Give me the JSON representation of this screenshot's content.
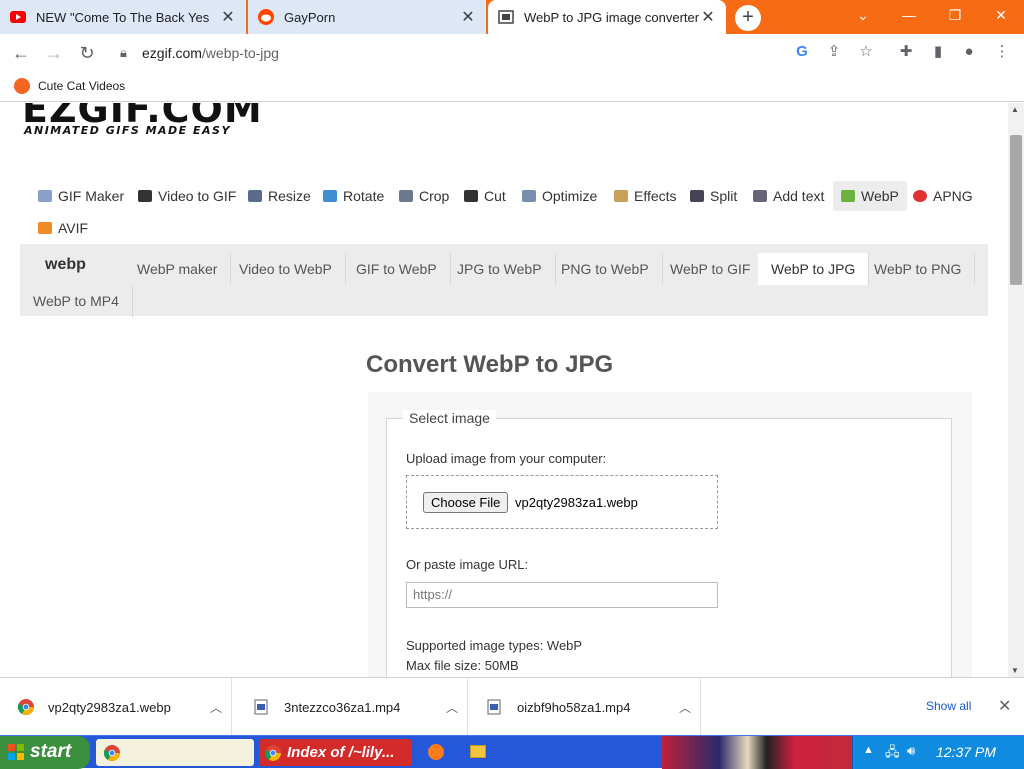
{
  "browser": {
    "tabs": [
      {
        "title": "NEW \"Come To The Back Yes",
        "icon": "youtube-icon",
        "active": false
      },
      {
        "title": "GayPorn",
        "icon": "reddit-icon",
        "active": false
      },
      {
        "title": "WebP to JPG image converter",
        "icon": "ezgif-icon",
        "active": true
      }
    ],
    "new_tab": "+",
    "url_host": "ezgif.com",
    "url_path": "/webp-to-jpg",
    "bookmarks": [
      {
        "label": "Cute Cat Videos"
      }
    ]
  },
  "site": {
    "logo": "EZGIF.COM",
    "tagline": "ANIMATED GIFS MADE EASY",
    "main_nav": [
      {
        "label": "GIF Maker",
        "icon": "gif-maker-icon"
      },
      {
        "label": "Video to GIF",
        "icon": "film-icon"
      },
      {
        "label": "Resize",
        "icon": "resize-icon"
      },
      {
        "label": "Rotate",
        "icon": "rotate-icon"
      },
      {
        "label": "Crop",
        "icon": "crop-icon"
      },
      {
        "label": "Cut",
        "icon": "cut-icon"
      },
      {
        "label": "Optimize",
        "icon": "optimize-icon"
      },
      {
        "label": "Effects",
        "icon": "palette-icon"
      },
      {
        "label": "Split",
        "icon": "split-icon"
      },
      {
        "label": "Add text",
        "icon": "text-icon"
      },
      {
        "label": "WebP",
        "icon": "webp-icon"
      },
      {
        "label": "APNG",
        "icon": "apng-icon"
      },
      {
        "label": "AVIF",
        "icon": "avif-icon"
      }
    ],
    "sub_logo": "webp",
    "sub_nav": [
      {
        "label": "WebP maker"
      },
      {
        "label": "Video to WebP"
      },
      {
        "label": "GIF to WebP"
      },
      {
        "label": "JPG to WebP"
      },
      {
        "label": "PNG to WebP"
      },
      {
        "label": "WebP to GIF"
      },
      {
        "label": "WebP to JPG"
      },
      {
        "label": "WebP to PNG"
      },
      {
        "label": "WebP to MP4"
      }
    ]
  },
  "form": {
    "heading": "Convert WebP to JPG",
    "legend": "Select image",
    "upload_label": "Upload image from your computer:",
    "choose_button": "Choose File",
    "file_name": "vp2qty2983za1.webp",
    "url_label": "Or paste image URL:",
    "url_placeholder": "https://",
    "supported": "Supported image types: WebP",
    "max_size": "Max file size: 50MB"
  },
  "downloads": {
    "items": [
      {
        "name": "vp2qty2983za1.webp",
        "icon": "chrome-icon"
      },
      {
        "name": "3ntezzco36za1.mp4",
        "icon": "file-icon"
      },
      {
        "name": "oizbf9ho58za1.mp4",
        "icon": "file-icon"
      }
    ],
    "show_all": "Show all"
  },
  "taskbar": {
    "start": "start",
    "tasks": [
      {
        "label": "Index of /~lily..."
      }
    ],
    "clock": "12:37 PM"
  }
}
